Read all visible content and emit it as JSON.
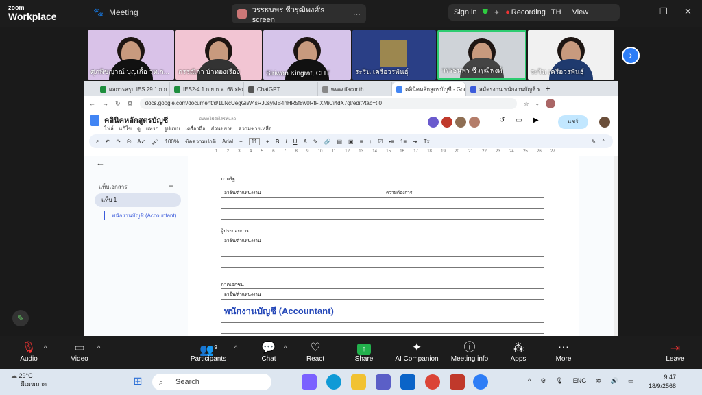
{
  "zoom": {
    "logo_top": "zoom",
    "logo_bottom": "Workplace",
    "meeting_label": "Meeting",
    "screen_label": "วรรธนพร ชีวรุ่ฒิพงศ์'s screen",
    "signin": "Sign in",
    "recording": "Recording",
    "lang": "TH",
    "view": "View"
  },
  "participants": [
    {
      "name": "ศุภพิชญาณ์ บุญเกื้อ วท.ก..."
    },
    {
      "name": "กรรณิกา บ้าทองเรือง"
    },
    {
      "name": "Siriwan Kingrat, CHT"
    },
    {
      "name": "ระริน เครือวรพันธุ์"
    },
    {
      "name": "วรรธนพร ชีวรุ่ฒิพงศ์"
    },
    {
      "name": "ระริน เครือวรพันธุ์"
    }
  ],
  "browser": {
    "tabs": [
      "ผลการสรุป IES 29 1 ก.ย. 68.xl",
      "IES2-4 1 ก.ย.ก.ค. 68.xlsx - G",
      "ChatGPT",
      "www.tfacor.th",
      "คลินิคหลักสูตรบัญชี - Google",
      "สมัครงาน พนักงานบัญชี ทางา"
    ],
    "url": "docs.google.com/document/d/1LNcUegGiW4sRJ0syMB4nHR5f8w0RfFlXMiCi4dX7ql/edit?tab=t.0"
  },
  "docs": {
    "title": "คลินิคหลักสูตรบัญชี",
    "saved": "บันทึกไปยังไดรฟ์แล้ว",
    "menu": [
      "ไฟล์",
      "แก้ไข",
      "ดู",
      "แทรก",
      "รูปแบบ",
      "เครื่องมือ",
      "ส่วนขยาย",
      "ความช่วยเหลือ"
    ],
    "share": "แชร์",
    "zoom_level": "100%",
    "style": "ข้อความปกติ",
    "font": "Arial",
    "font_size": "11",
    "ruler": [
      "1",
      "2",
      "3",
      "4",
      "5",
      "6",
      "7",
      "8",
      "9",
      "10",
      "11",
      "12",
      "13",
      "14",
      "15",
      "16",
      "17",
      "18",
      "19",
      "20",
      "21",
      "22",
      "23",
      "24",
      "25",
      "26",
      "27"
    ],
    "outline_label": "แท็บเอกสาร",
    "tab1": "แท็บ 1",
    "heading": "พนักงานบัญชี (Accountant)",
    "sections": [
      {
        "label": "ภาครัฐ",
        "col1": "อาชีพ/ตำแหน่งงาน",
        "col2": "ความต้องการ"
      },
      {
        "label": "ผู้ประกอบการ",
        "col1": "อาชีพ/ตำแหน่งงาน",
        "col2": ""
      },
      {
        "label": "ภาคเอกชน",
        "col1": "อาชีพ/ตำแหน่งงาน",
        "col2": ""
      }
    ],
    "big_cell": "พนักงานบัญชี (Accountant)"
  },
  "bottom": {
    "audio": "Audio",
    "video": "Video",
    "participants": "Participants",
    "participants_count": "9",
    "chat": "Chat",
    "react": "React",
    "share": "Share",
    "ai": "AI Companion",
    "info": "Meeting info",
    "apps": "Apps",
    "more": "More",
    "leave": "Leave"
  },
  "taskbar": {
    "temp": "29°C",
    "weather": "มีเมฆมาก",
    "search": "Search",
    "lang": "ENG",
    "time": "9:47",
    "date": "18/9/2568"
  },
  "colors": {
    "zoom_blue": "#2d7df6",
    "share_green": "#22b14c",
    "docs_blue": "#4285f4",
    "link_blue": "#3b5bdb"
  }
}
